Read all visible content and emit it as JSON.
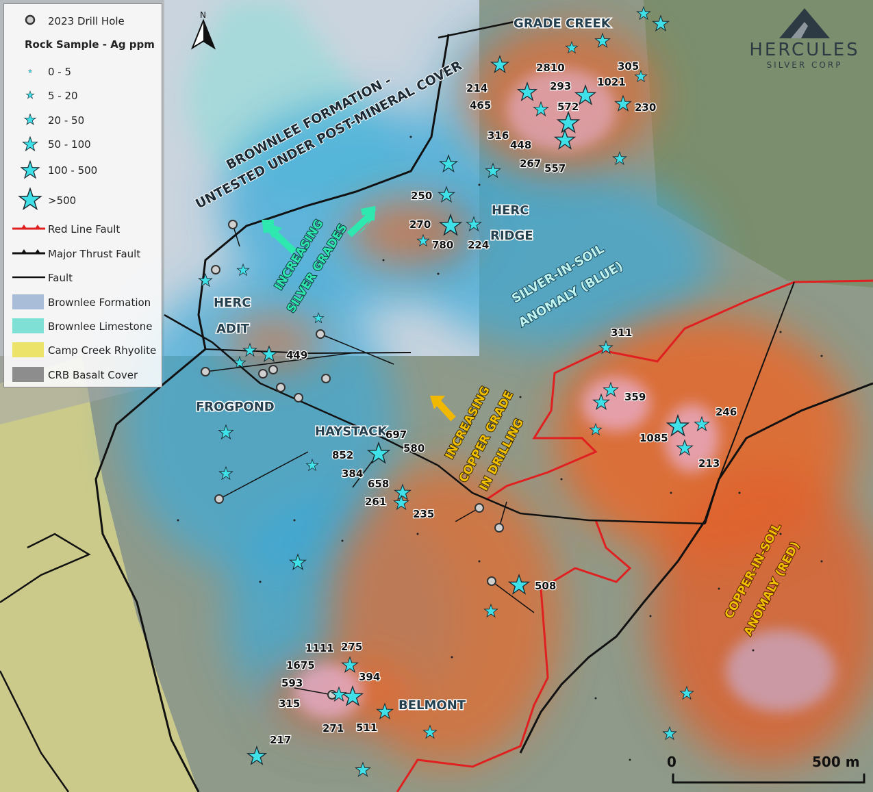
{
  "legend": {
    "drill_hole": "2023 Drill Hole",
    "rock_sample_title": "Rock Sample - Ag ppm",
    "rock_classes": [
      "0 - 5",
      "5 - 20",
      "20 - 50",
      "50 - 100",
      "100 - 500",
      ">500"
    ],
    "lines": [
      "Red Line Fault",
      "Major Thrust Fault",
      "Fault"
    ],
    "units": [
      {
        "label": "Brownlee Formation",
        "color": "#a9bcd8"
      },
      {
        "label": "Brownlee Limestone",
        "color": "#7fe0d6"
      },
      {
        "label": "Camp Creek Rhyolite",
        "color": "#ece36a"
      },
      {
        "label": "CRB Basalt Cover",
        "color": "#8d8d8d"
      }
    ]
  },
  "north_arrow": "N",
  "logo": {
    "name": "HERCULES",
    "sub": "SILVER CORP"
  },
  "scale_bar": {
    "start": "0",
    "end": "500 m"
  },
  "place_labels": [
    {
      "text": "GRADE CREEK",
      "color": "#24404f"
    },
    {
      "text": "HERC",
      "color": "#24404f"
    },
    {
      "text": "RIDGE",
      "color": "#24404f"
    },
    {
      "text": "HERC",
      "color": "#24404f"
    },
    {
      "text": "ADIT",
      "color": "#24404f"
    },
    {
      "text": "FROGPOND",
      "color": "#24404f"
    },
    {
      "text": "HAYSTACK",
      "color": "#24404f"
    },
    {
      "text": "BELMONT",
      "color": "#24404f"
    }
  ],
  "annotations": {
    "brownlee_1": "BROWNLEE FORMATION -",
    "brownlee_2": "UNTESTED UNDER POST-MINERAL COVER",
    "silver_1": "INCREASING",
    "silver_2": "SILVER GRADES",
    "copper_1": "INCREASING",
    "copper_2": "COPPER GRADE",
    "copper_3": "IN DRILLING",
    "ag_soil_1": "SILVER-IN-SOIL",
    "ag_soil_2": "ANOMALY (BLUE)",
    "cu_soil_1": "COPPER-IN-SOIL",
    "cu_soil_2": "ANOMALY (RED)"
  },
  "sample_values": [
    "305",
    "2810",
    "1021",
    "214",
    "293",
    "465",
    "572",
    "230",
    "316",
    "448",
    "267",
    "557",
    "250",
    "270",
    "224",
    "780",
    "449",
    "311",
    "359",
    "246",
    "1085",
    "213",
    "697",
    "852",
    "580",
    "384",
    "658",
    "261",
    "235",
    "508",
    "1111",
    "275",
    "1675",
    "394",
    "593",
    "315",
    "271",
    "511",
    "217"
  ],
  "colors": {
    "red_line_fault": "#e02020",
    "thrust_fault": "#111111",
    "sample_star": "#3fe0e8",
    "silver_anomaly": "#58b8e0",
    "copper_anomaly": "#e8682a",
    "silver_arrow": "#2ee8b0",
    "copper_arrow": "#f0b800"
  }
}
